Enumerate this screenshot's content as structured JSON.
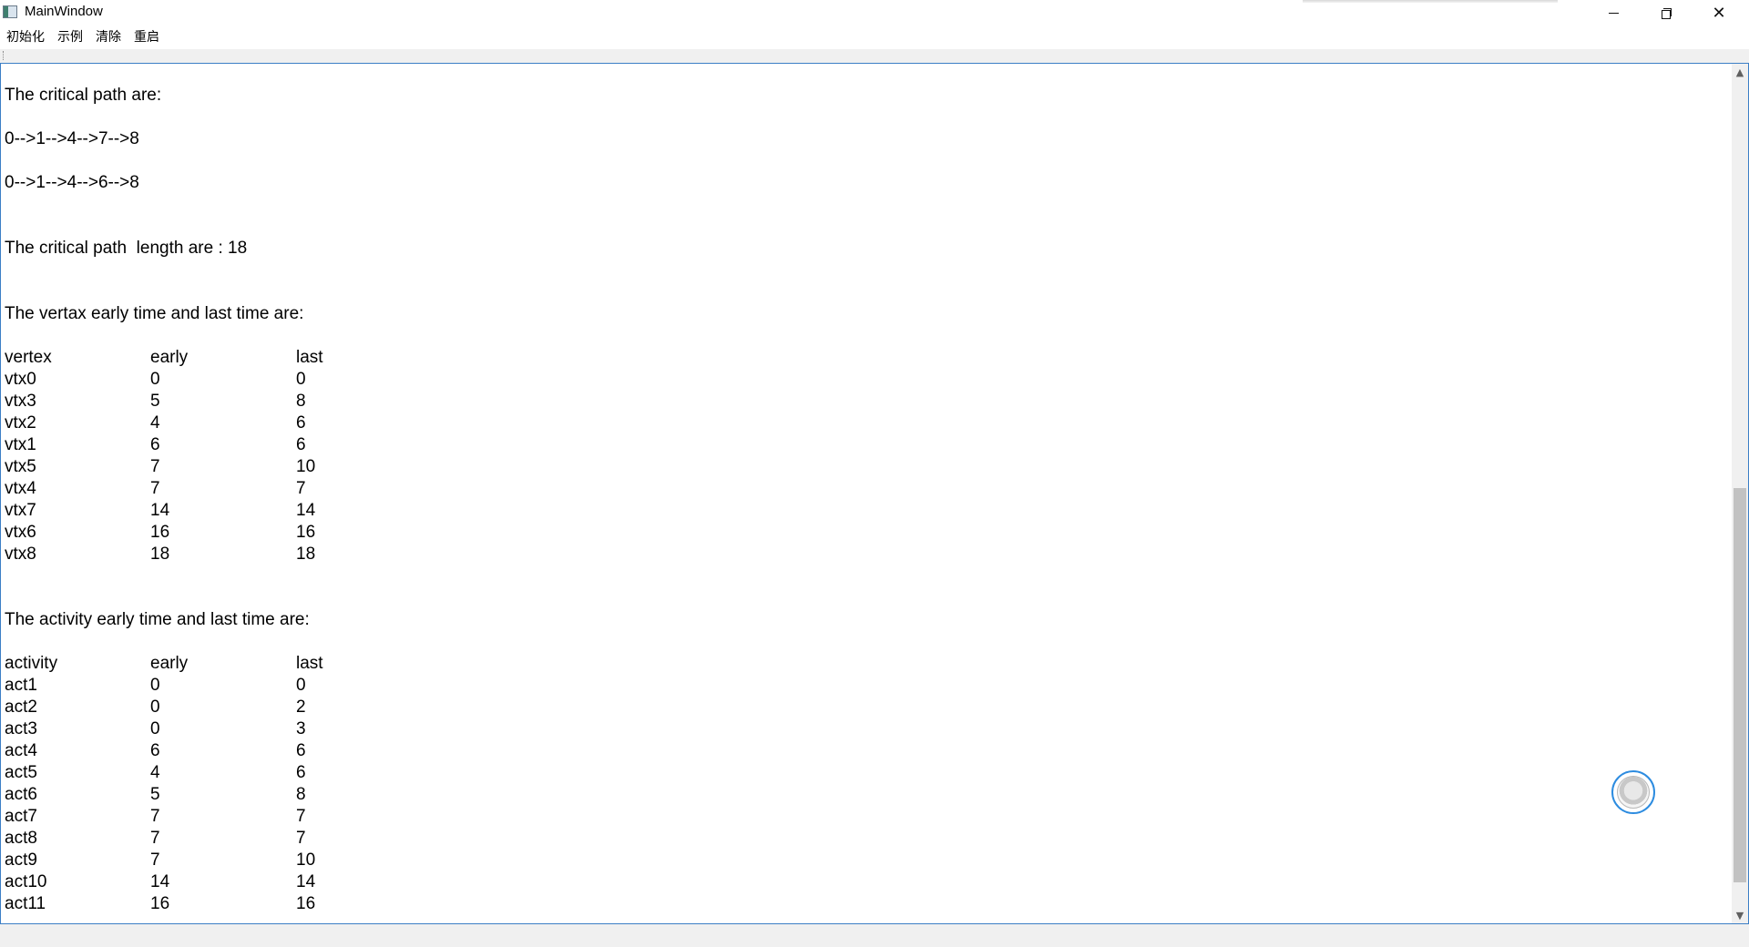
{
  "window": {
    "title": "MainWindow"
  },
  "menu": {
    "items": [
      "初始化",
      "示例",
      "清除",
      "重启"
    ]
  },
  "output": {
    "critical_path_heading": "The critical path are:",
    "paths": [
      "0-->1-->4-->7-->8",
      "0-->1-->4-->6-->8"
    ],
    "length_line": "The critical path  length are : 18",
    "vertex_heading": "The vertax early time and last time are:",
    "vertex_table": {
      "headers": [
        "vertex",
        "early",
        "last"
      ],
      "rows": [
        [
          "vtx0",
          "0",
          "0"
        ],
        [
          "vtx3",
          "5",
          "8"
        ],
        [
          "vtx2",
          "4",
          "6"
        ],
        [
          "vtx1",
          "6",
          "6"
        ],
        [
          "vtx5",
          "7",
          "10"
        ],
        [
          "vtx4",
          "7",
          "7"
        ],
        [
          "vtx7",
          "14",
          "14"
        ],
        [
          "vtx6",
          "16",
          "16"
        ],
        [
          "vtx8",
          "18",
          "18"
        ]
      ]
    },
    "activity_heading": "The activity early time and last time are:",
    "activity_table": {
      "headers": [
        "activity",
        "early",
        "last"
      ],
      "rows": [
        [
          "act1",
          "0",
          "0"
        ],
        [
          "act2",
          "0",
          "2"
        ],
        [
          "act3",
          "0",
          "3"
        ],
        [
          "act4",
          "6",
          "6"
        ],
        [
          "act5",
          "4",
          "6"
        ],
        [
          "act6",
          "5",
          "8"
        ],
        [
          "act7",
          "7",
          "7"
        ],
        [
          "act8",
          "7",
          "7"
        ],
        [
          "act9",
          "7",
          "10"
        ],
        [
          "act10",
          "14",
          "14"
        ],
        [
          "act11",
          "16",
          "16"
        ]
      ]
    }
  },
  "icons": {
    "minimize": "minimize-icon",
    "restore": "restore-icon",
    "close": "close-icon",
    "scroll_up": "scroll-up-icon",
    "scroll_down": "scroll-down-icon",
    "assistant": "assistant-float-icon"
  },
  "colors": {
    "accent": "#3c7fc6",
    "float_border": "#2d8ce0"
  }
}
